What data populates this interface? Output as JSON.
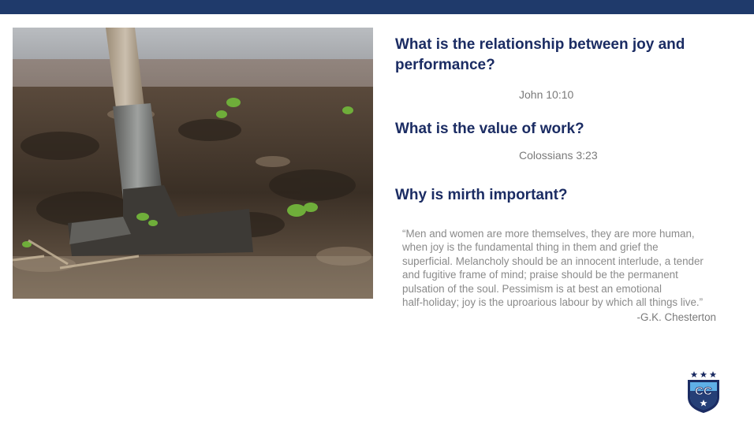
{
  "slide": {
    "questions": [
      "What is the relationship between joy and performance?",
      "What is the value of work?",
      "Why is mirth important?"
    ],
    "references": [
      "John 10:10",
      "Colossians 3:23"
    ],
    "quote_lines": [
      "“Men and women are more themselves, they are more human,",
      "when joy is the fundamental thing in them and grief the",
      "superficial. Melancholy should be an innocent interlude, a tender",
      "and fugitive frame of mind; praise should be the permanent",
      "pulsation of the soul. Pessimism is at best an emotional",
      "half-holiday; joy is the uproarious labour by which all things live.”"
    ],
    "quote_author": "-G.K. Chesterton"
  },
  "logo": {
    "text": "CC",
    "colors": {
      "navy": "#1b2c63",
      "light_blue": "#5fb0e6"
    }
  },
  "colors": {
    "top_bar": "#1f3a6b",
    "heading": "#1b2c63",
    "body_text": "#7a7a7a"
  },
  "icons": {
    "photo": "shovel-in-soil-photo",
    "logo": "shield-crest-icon"
  }
}
